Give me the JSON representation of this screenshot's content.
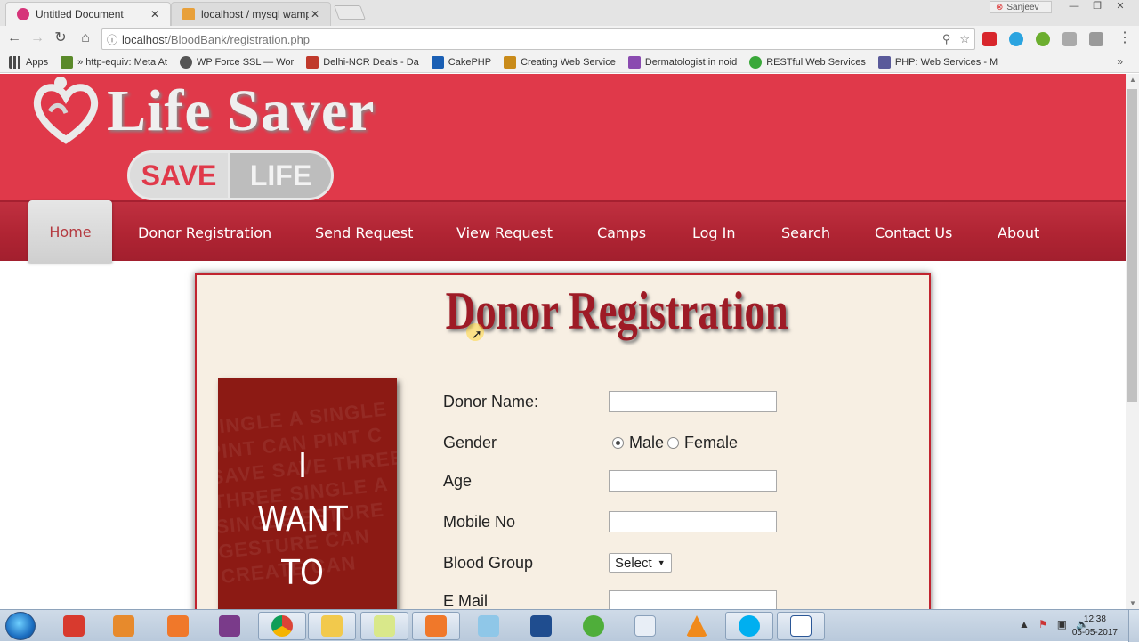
{
  "browser": {
    "tabs": [
      {
        "title": "Untitled Document",
        "favicon": "m-icon",
        "color": "#d6357a"
      },
      {
        "title": "localhost / mysql wamps",
        "favicon": "pma-icon",
        "color": "#e8a03a"
      }
    ],
    "profile": "Sanjeev",
    "url_host": "localhost",
    "url_path": "/BloodBank/registration.php",
    "bookmarks_apps": "Apps",
    "bookmarks": [
      {
        "label": "» http-equiv: Meta At",
        "color": "#5a8a2a"
      },
      {
        "label": "WP Force SSL — Wor",
        "color": "#555555"
      },
      {
        "label": "Delhi-NCR Deals - Da",
        "color": "#c0392b"
      },
      {
        "label": "CakePHP",
        "color": "#1a5fb4"
      },
      {
        "label": "Creating Web Service",
        "color": "#c98b1a"
      },
      {
        "label": "Dermatologist in noid",
        "color": "#8a4bb0"
      },
      {
        "label": "RESTful Web Services",
        "color": "#3aa83a"
      },
      {
        "label": "PHP: Web Services - M",
        "color": "#5a5a9a"
      }
    ]
  },
  "site": {
    "logo_title": "Life Saver",
    "badge_left": "SAVE",
    "badge_right": "LIFE",
    "header_color": "#e0394a",
    "nav": [
      {
        "label": "Home",
        "active": true
      },
      {
        "label": "Donor Registration"
      },
      {
        "label": "Send Request"
      },
      {
        "label": "View Request"
      },
      {
        "label": "Camps"
      },
      {
        "label": "Log In"
      },
      {
        "label": "Search"
      },
      {
        "label": "Contact Us"
      },
      {
        "label": "About"
      }
    ]
  },
  "form": {
    "title": "Donor Registration",
    "poster_line1": "I",
    "poster_line2": "WANT",
    "poster_line3": "TO",
    "poster_bg": "SINGLE A SINGLE PINT CAN PINT C SAVE SAVE THREE THREE SINGLE A SINGLE ESTURE GESTURE CAN CREATE CAN",
    "fields": {
      "donor_name": {
        "label": "Donor Name:",
        "value": ""
      },
      "gender": {
        "label": "Gender",
        "options": [
          "Male",
          "Female"
        ],
        "selected": "Male"
      },
      "age": {
        "label": "Age",
        "value": ""
      },
      "mobile": {
        "label": "Mobile No",
        "value": ""
      },
      "blood_group": {
        "label": "Blood Group",
        "value": "Select"
      },
      "email": {
        "label": "E Mail",
        "value": ""
      }
    }
  },
  "taskbar": {
    "clock_time": "12:38",
    "clock_date": "05-05-2017"
  }
}
